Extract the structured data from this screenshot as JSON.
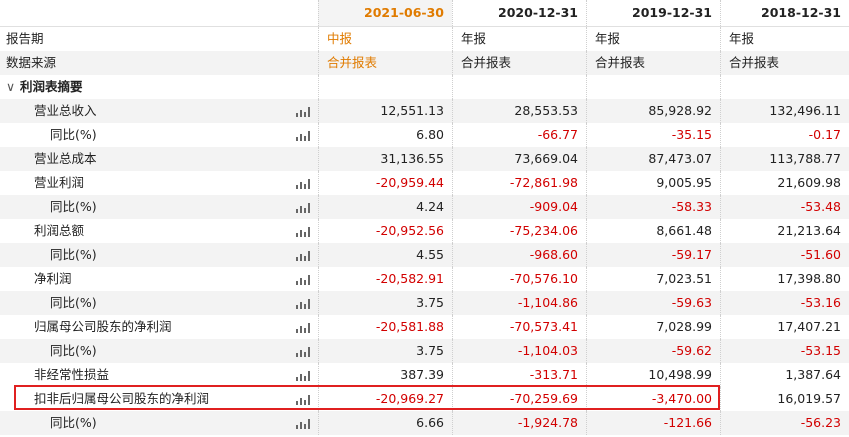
{
  "columns": [
    "2021-06-30",
    "2020-12-31",
    "2019-12-31",
    "2018-12-31"
  ],
  "rows": [
    {
      "label": "报告期",
      "values": [
        "中报",
        "年报",
        "年报",
        "年报"
      ]
    },
    {
      "label": "数据来源",
      "values": [
        "合并报表",
        "合并报表",
        "合并报表",
        "合并报表"
      ]
    },
    {
      "label": "利润表摘要",
      "section_toggle": "∨"
    },
    {
      "label": "营业总收入",
      "values": [
        "12,551.13",
        "28,553.53",
        "85,928.92",
        "132,496.11"
      ]
    },
    {
      "label": "同比(%)",
      "values": [
        "6.80",
        "-66.77",
        "-35.15",
        "-0.17"
      ]
    },
    {
      "label": "营业总成本",
      "values": [
        "31,136.55",
        "73,669.04",
        "87,473.07",
        "113,788.77"
      ]
    },
    {
      "label": "营业利润",
      "values": [
        "-20,959.44",
        "-72,861.98",
        "9,005.95",
        "21,609.98"
      ]
    },
    {
      "label": "同比(%)",
      "values": [
        "4.24",
        "-909.04",
        "-58.33",
        "-53.48"
      ]
    },
    {
      "label": "利润总额",
      "values": [
        "-20,952.56",
        "-75,234.06",
        "8,661.48",
        "21,213.64"
      ]
    },
    {
      "label": "同比(%)",
      "values": [
        "4.55",
        "-968.60",
        "-59.17",
        "-51.60"
      ]
    },
    {
      "label": "净利润",
      "values": [
        "-20,582.91",
        "-70,576.10",
        "7,023.51",
        "17,398.80"
      ]
    },
    {
      "label": "同比(%)",
      "values": [
        "3.75",
        "-1,104.86",
        "-59.63",
        "-53.16"
      ]
    },
    {
      "label": "归属母公司股东的净利润",
      "values": [
        "-20,581.88",
        "-70,573.41",
        "7,028.99",
        "17,407.21"
      ]
    },
    {
      "label": "同比(%)",
      "values": [
        "3.75",
        "-1,104.03",
        "-59.62",
        "-53.15"
      ]
    },
    {
      "label": "非经常性损益",
      "values": [
        "387.39",
        "-313.71",
        "10,498.99",
        "1,387.64"
      ]
    },
    {
      "label": "扣非后归属母公司股东的净利润",
      "values": [
        "-20,969.27",
        "-70,259.69",
        "-3,470.00",
        "16,019.57"
      ]
    },
    {
      "label": "同比(%)",
      "values": [
        "6.66",
        "-1,924.78",
        "-121.66",
        "-56.23"
      ]
    }
  ],
  "colors": {
    "highlight_border": "#e02020",
    "accent_orange": "#e07b00",
    "negative": "#d20000"
  }
}
